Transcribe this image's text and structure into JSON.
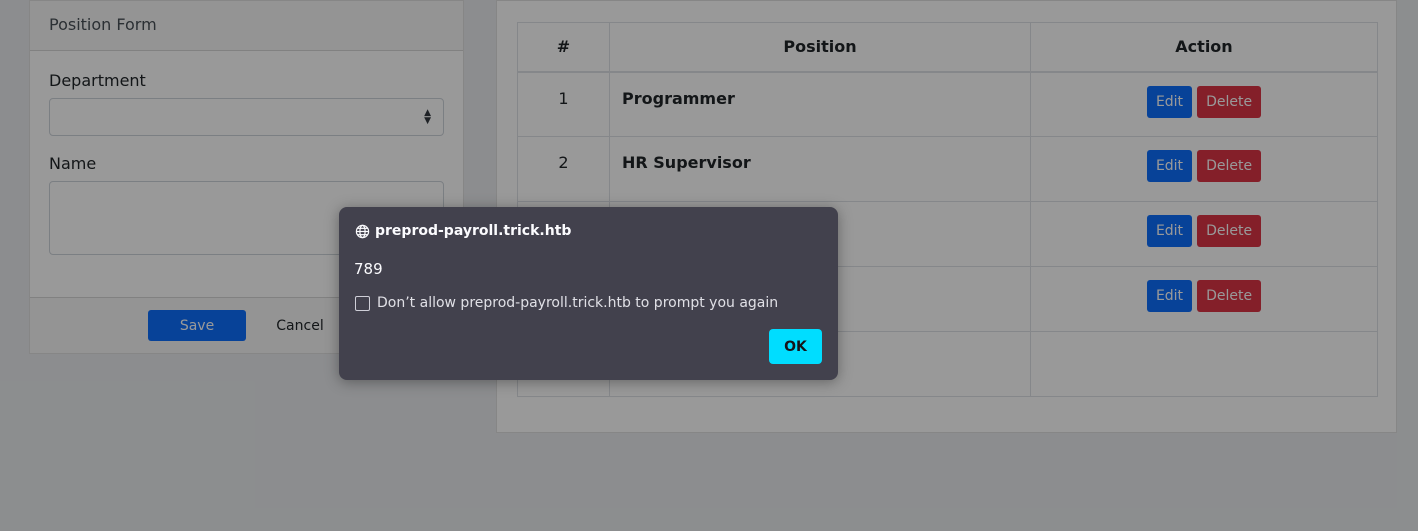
{
  "form": {
    "title": "Position Form",
    "department_label": "Department",
    "department_value": "",
    "name_label": "Name",
    "name_value": "",
    "save_label": "Save",
    "cancel_label": "Cancel"
  },
  "table": {
    "headers": [
      "#",
      "Position",
      "Action"
    ],
    "rows": [
      {
        "num": "1",
        "position": "Programmer",
        "edit": "Edit",
        "delete": "Delete"
      },
      {
        "num": "2",
        "position": "HR Supervisor",
        "edit": "Edit",
        "delete": "Delete"
      },
      {
        "num": "",
        "position": "",
        "edit": "Edit",
        "delete": "Delete"
      },
      {
        "num": "",
        "position": "",
        "edit": "Edit",
        "delete": "Delete"
      },
      {
        "num": "",
        "position": "",
        "edit": "",
        "delete": ""
      }
    ]
  },
  "dialog": {
    "host": "preprod-payroll.trick.htb",
    "message": "789",
    "checkbox_label": "Don’t allow preprod-payroll.trick.htb to prompt you again",
    "ok_label": "OK",
    "icon": "globe-icon"
  },
  "colors": {
    "primary": "#0d6efd",
    "danger": "#dc3545",
    "dialog_bg": "#42414d",
    "ok_button": "#00ddff"
  }
}
